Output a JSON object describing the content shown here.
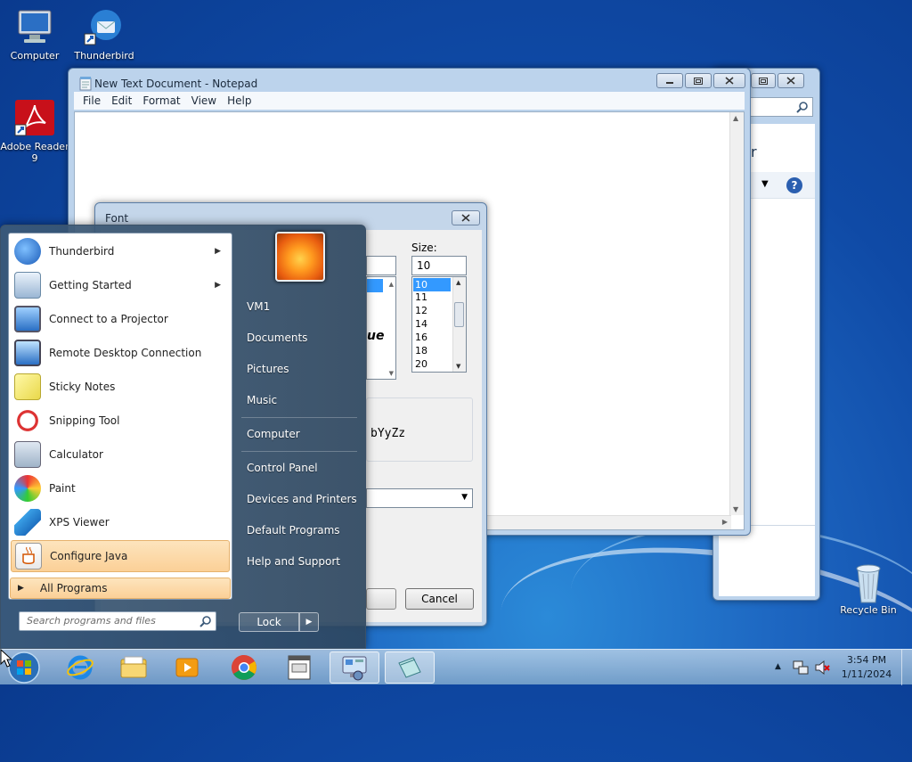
{
  "desktop": {
    "icons": [
      {
        "label": "Computer"
      },
      {
        "label": "Thunderbird"
      },
      {
        "label": "Adobe Reader 9"
      },
      {
        "label": "Recycle Bin"
      }
    ]
  },
  "notepad": {
    "title": "New Text Document - Notepad",
    "menu": [
      "File",
      "Edit",
      "Format",
      "View",
      "Help"
    ]
  },
  "explorer_bg": {
    "partial_text": "r"
  },
  "font_dialog": {
    "title": "Font",
    "size_label": "Size:",
    "size_value": "10",
    "sizes": [
      "10",
      "11",
      "12",
      "14",
      "16",
      "18",
      "20"
    ],
    "style_sample": "ue",
    "preview_text": "bYyZz",
    "cancel_label": "Cancel"
  },
  "start_menu": {
    "programs": [
      {
        "label": "Thunderbird",
        "submenu": true
      },
      {
        "label": "Getting Started",
        "submenu": true
      },
      {
        "label": "Connect to a Projector"
      },
      {
        "label": "Remote Desktop Connection"
      },
      {
        "label": "Sticky Notes"
      },
      {
        "label": "Snipping Tool"
      },
      {
        "label": "Calculator"
      },
      {
        "label": "Paint"
      },
      {
        "label": "XPS Viewer"
      },
      {
        "label": "Configure Java"
      }
    ],
    "all_programs": "All Programs",
    "search_placeholder": "Search programs and files",
    "right_links": [
      "VM1",
      "Documents",
      "Pictures",
      "Music",
      "Computer",
      "Control Panel",
      "Devices and Printers",
      "Default Programs",
      "Help and Support"
    ],
    "lock_label": "Lock"
  },
  "taskbar": {
    "time": "3:54 PM",
    "date": "1/11/2024"
  }
}
